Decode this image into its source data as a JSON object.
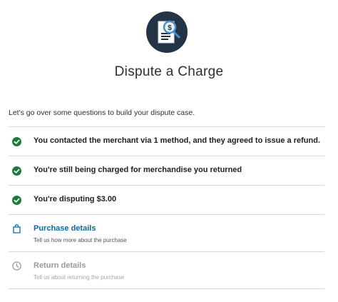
{
  "header": {
    "title": "Dispute a Charge",
    "icon": "document-dollar-magnifier-icon"
  },
  "intro": "Let's go over some questions to build your dispute case.",
  "completed": [
    {
      "label": "You contacted the merchant via 1 method, and they agreed to issue a refund.",
      "icon": "check-circle-icon"
    },
    {
      "label": "You're still being charged for merchandise you returned",
      "icon": "check-circle-icon"
    },
    {
      "label": "You're disputing $3.00",
      "icon": "check-circle-icon"
    }
  ],
  "steps": [
    {
      "label": "Purchase details",
      "subtitle": "Tell us how more about the purchase",
      "icon": "shopping-bag-icon",
      "state": "active"
    },
    {
      "label": "Return details",
      "subtitle": "Tell us about returning the purchase",
      "icon": "clock-icon",
      "state": "disabled"
    }
  ],
  "colors": {
    "check": "#1e7a3c",
    "active_link": "#0a6aa8",
    "disabled": "#9a9a9a",
    "hero_bg": "#243447",
    "divider": "#d9d9d9"
  }
}
